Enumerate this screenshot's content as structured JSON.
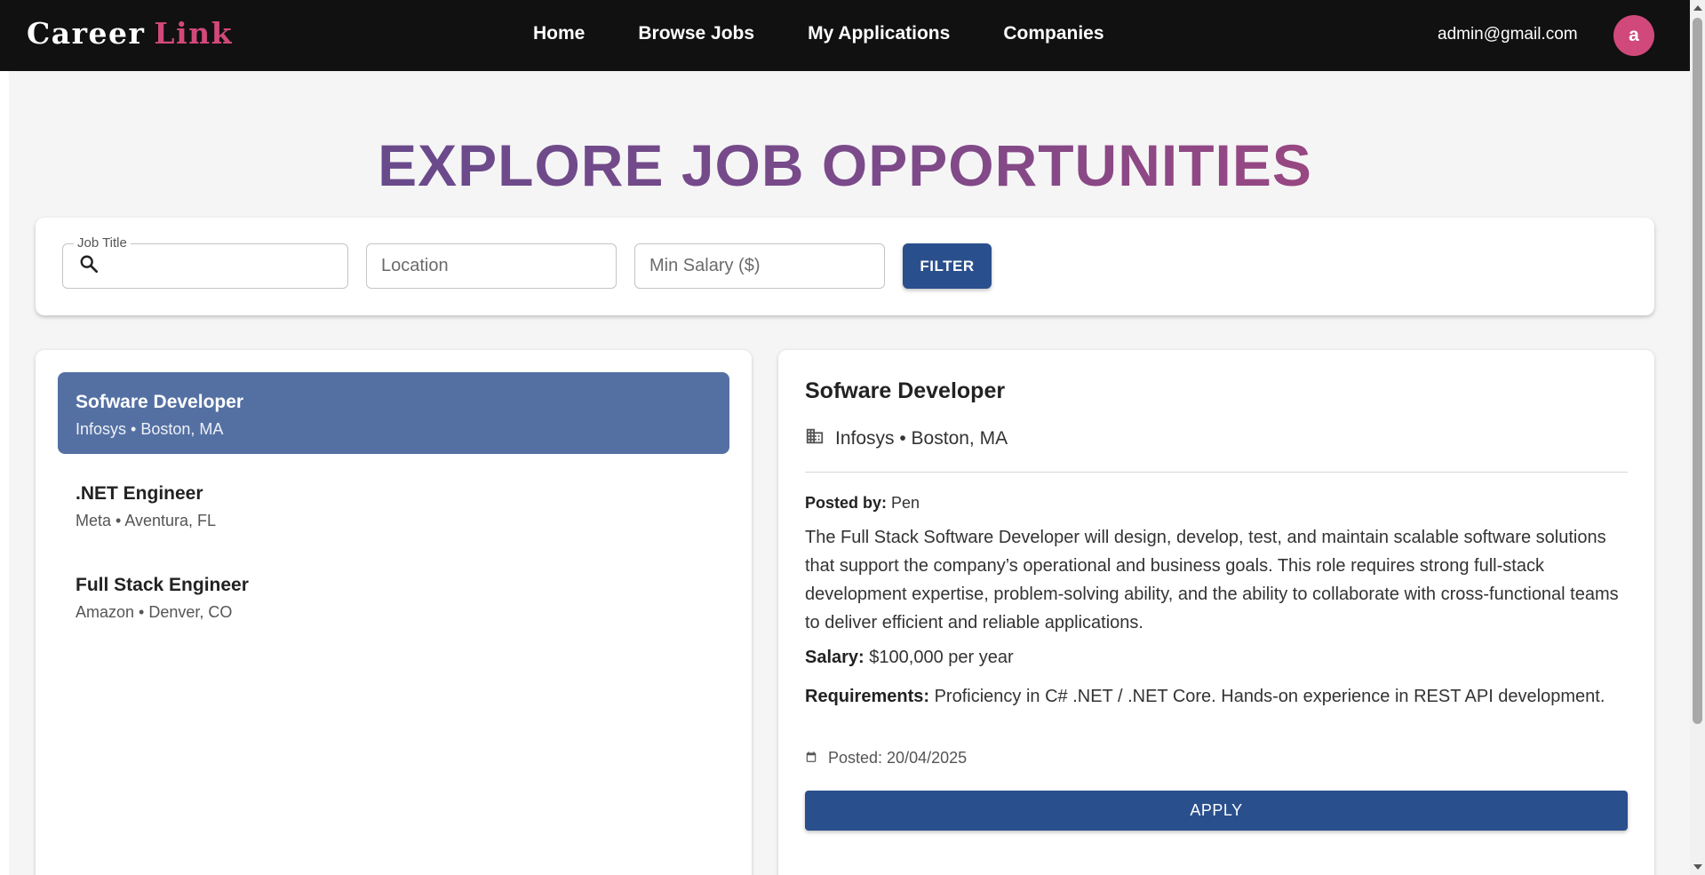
{
  "brand": {
    "part1": "Career",
    "part2": "Link",
    "accent": "#d1497a"
  },
  "nav": {
    "links": [
      {
        "label": "Home"
      },
      {
        "label": "Browse Jobs"
      },
      {
        "label": "My Applications"
      },
      {
        "label": "Companies"
      }
    ],
    "user_email": "admin@gmail.com",
    "avatar_initial": "a"
  },
  "hero": {
    "title": "EXPLORE JOB OPPORTUNITIES"
  },
  "filters": {
    "job_title_label": "Job Title",
    "job_title_value": "",
    "location_placeholder": "Location",
    "min_salary_placeholder": "Min Salary ($)",
    "filter_button": "FILTER"
  },
  "jobs": [
    {
      "title": "Sofware Developer",
      "subtitle": "Infosys • Boston, MA",
      "selected": true
    },
    {
      "title": ".NET Engineer",
      "subtitle": "Meta • Aventura, FL",
      "selected": false
    },
    {
      "title": "Full Stack Engineer",
      "subtitle": "Amazon • Denver, CO",
      "selected": false
    }
  ],
  "detail": {
    "title": "Sofware Developer",
    "company_line": "Infosys • Boston, MA",
    "posted_by_label": "Posted by:",
    "posted_by": "Pen",
    "description": "The Full Stack Software Developer will design, develop, test, and maintain scalable software solutions that support the company’s operational and business goals. This role requires strong full-stack development expertise, problem-solving ability, and the ability to collaborate with cross-functional teams to deliver efficient and reliable applications.",
    "salary_label": "Salary:",
    "salary": "$100,000 per year",
    "requirements_label": "Requirements:",
    "requirements": "Proficiency in C# .NET / .NET Core. Hands-on experience in REST API development.",
    "posted_date": "Posted: 20/04/2025",
    "apply_button": "APPLY"
  },
  "colors": {
    "navbar": "#111111",
    "primary_button": "#2a4f8d",
    "selected_item": "#5470a3",
    "title_gradient_start": "#5b4a8c",
    "title_gradient_end": "#b0457c"
  },
  "icons": [
    "search-icon",
    "building-icon",
    "calendar-icon"
  ]
}
